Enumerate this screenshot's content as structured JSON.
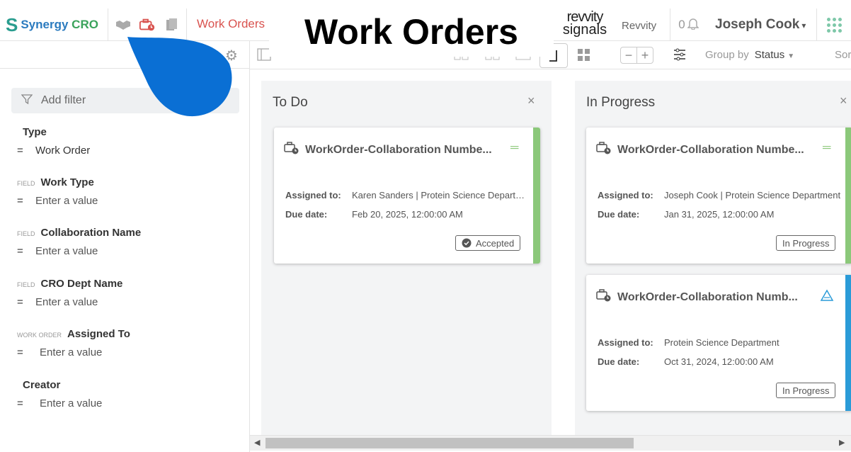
{
  "header": {
    "brand_name": "Synergy",
    "brand_suffix": "CRO",
    "nav_title": "Work Orders",
    "overlay_title": "Work Orders",
    "partner_logo_line1": "revvity",
    "partner_logo_line2": "signals",
    "tenant": "Revvity",
    "notification_count": "0",
    "user_name": "Joseph Cook",
    "user_caret": "▾"
  },
  "filters": {
    "add_filter_placeholder": "Add filter",
    "groups": [
      {
        "tag": "",
        "label": "Type",
        "op": "=",
        "value": "Work Order"
      },
      {
        "tag": "FIELD",
        "label": "Work Type",
        "op": "=",
        "value": "Enter a value"
      },
      {
        "tag": "FIELD",
        "label": "Collaboration Name",
        "op": "=",
        "value": "Enter a value"
      },
      {
        "tag": "FIELD",
        "label": "CRO Dept Name",
        "op": "=",
        "value": "Enter a value"
      },
      {
        "tag": "WORK ORDER",
        "label": "Assigned To",
        "op": "=",
        "value": "Enter a value"
      },
      {
        "tag": "",
        "label": "Creator",
        "op": "=",
        "value": "Enter a value"
      }
    ]
  },
  "toolbar": {
    "zoom_out": "−",
    "zoom_in": "+",
    "group_by_label": "Group by",
    "group_by_value": "Status",
    "sort_label": "Sor"
  },
  "board": {
    "columns": [
      {
        "title": "To Do",
        "close": "×",
        "cards": [
          {
            "title": "WorkOrder-Collaboration Numbe...",
            "assigned_label": "Assigned to:",
            "assigned_value": "Karen Sanders | Protein Science Departm...",
            "due_label": "Due date:",
            "due_value": "Feb 20, 2025, 12:00:00 AM",
            "status": "Accepted",
            "bar_color": "#8bc87a"
          }
        ]
      },
      {
        "title": "In Progress",
        "close": "×",
        "cards": [
          {
            "title": "WorkOrder-Collaboration Numbe...",
            "assigned_label": "Assigned to:",
            "assigned_value": "Joseph Cook | Protein Science Department",
            "due_label": "Due date:",
            "due_value": "Jan 31, 2025, 12:00:00 AM",
            "status": "In Progress",
            "bar_color": "#8bc87a"
          },
          {
            "title": "WorkOrder-Collaboration Numb...",
            "assigned_label": "Assigned to:",
            "assigned_value": "Protein Science Department",
            "due_label": "Due date:",
            "due_value": "Oct 31, 2024, 12:00:00 AM",
            "status": "In Progress",
            "bar_color": "#2a9bd8"
          }
        ]
      }
    ]
  },
  "colors": {
    "accent_red": "#d9534f",
    "brand_blue": "#2b7bbf",
    "brand_green": "#3aa35b",
    "drop_blue": "#0a6fd4"
  }
}
